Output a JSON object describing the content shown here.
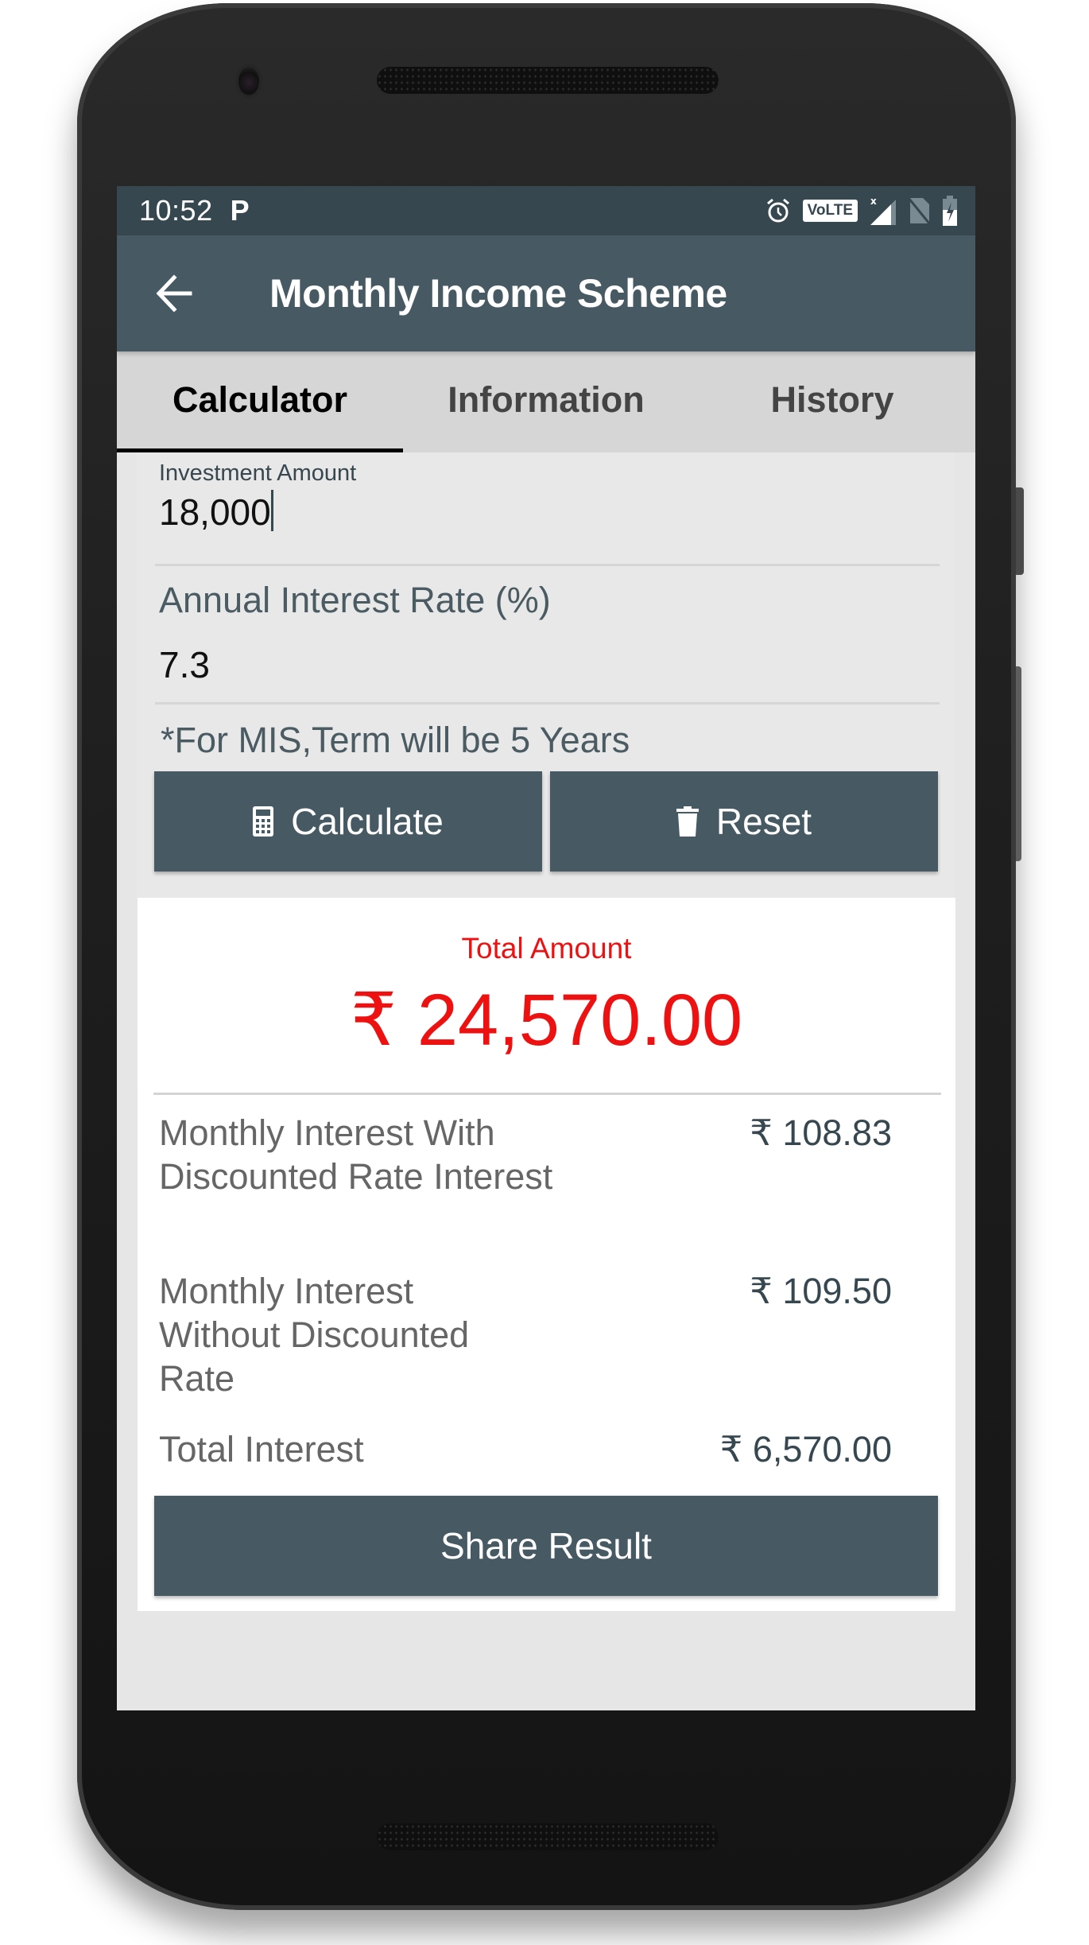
{
  "status_bar": {
    "time": "10:52",
    "notification_icon": "parking-p-icon",
    "icons": [
      "alarm-icon",
      "volte-icon",
      "signal-icon",
      "no-sim-icon",
      "battery-charging-icon"
    ],
    "volte_label": "VoLTE",
    "signal_badge": "x"
  },
  "app_bar": {
    "back_icon": "arrow-left-icon",
    "title": "Monthly Income Scheme"
  },
  "tabs": [
    {
      "label": "Calculator",
      "active": true
    },
    {
      "label": "Information",
      "active": false
    },
    {
      "label": "History",
      "active": false
    }
  ],
  "form": {
    "investment_amount": {
      "label": "Investment Amount",
      "value": "18,000"
    },
    "interest_rate": {
      "label": "Annual Interest Rate (%)",
      "value": "7.3"
    },
    "note": "*For MIS,Term will be 5 Years",
    "calculate_button": {
      "label": "Calculate",
      "icon": "calculator-icon"
    },
    "reset_button": {
      "label": "Reset",
      "icon": "trash-icon"
    }
  },
  "result": {
    "total_label": "Total Amount",
    "total_value": "₹ 24,570.00",
    "rows": [
      {
        "label": "Monthly Interest With Discounted Rate Interest",
        "value": "₹ 108.83"
      },
      {
        "label": "Monthly Interest Without Discounted Rate",
        "value": "₹ 109.50"
      },
      {
        "label": "Total Interest",
        "value": "₹ 6,570.00"
      }
    ],
    "share_button": "Share Result"
  },
  "colors": {
    "status_bar": "#37474f",
    "app_bar": "#475a63",
    "tab_bar": "#d6d6d6",
    "accent_red": "#ee1111",
    "button": "#475a63"
  }
}
